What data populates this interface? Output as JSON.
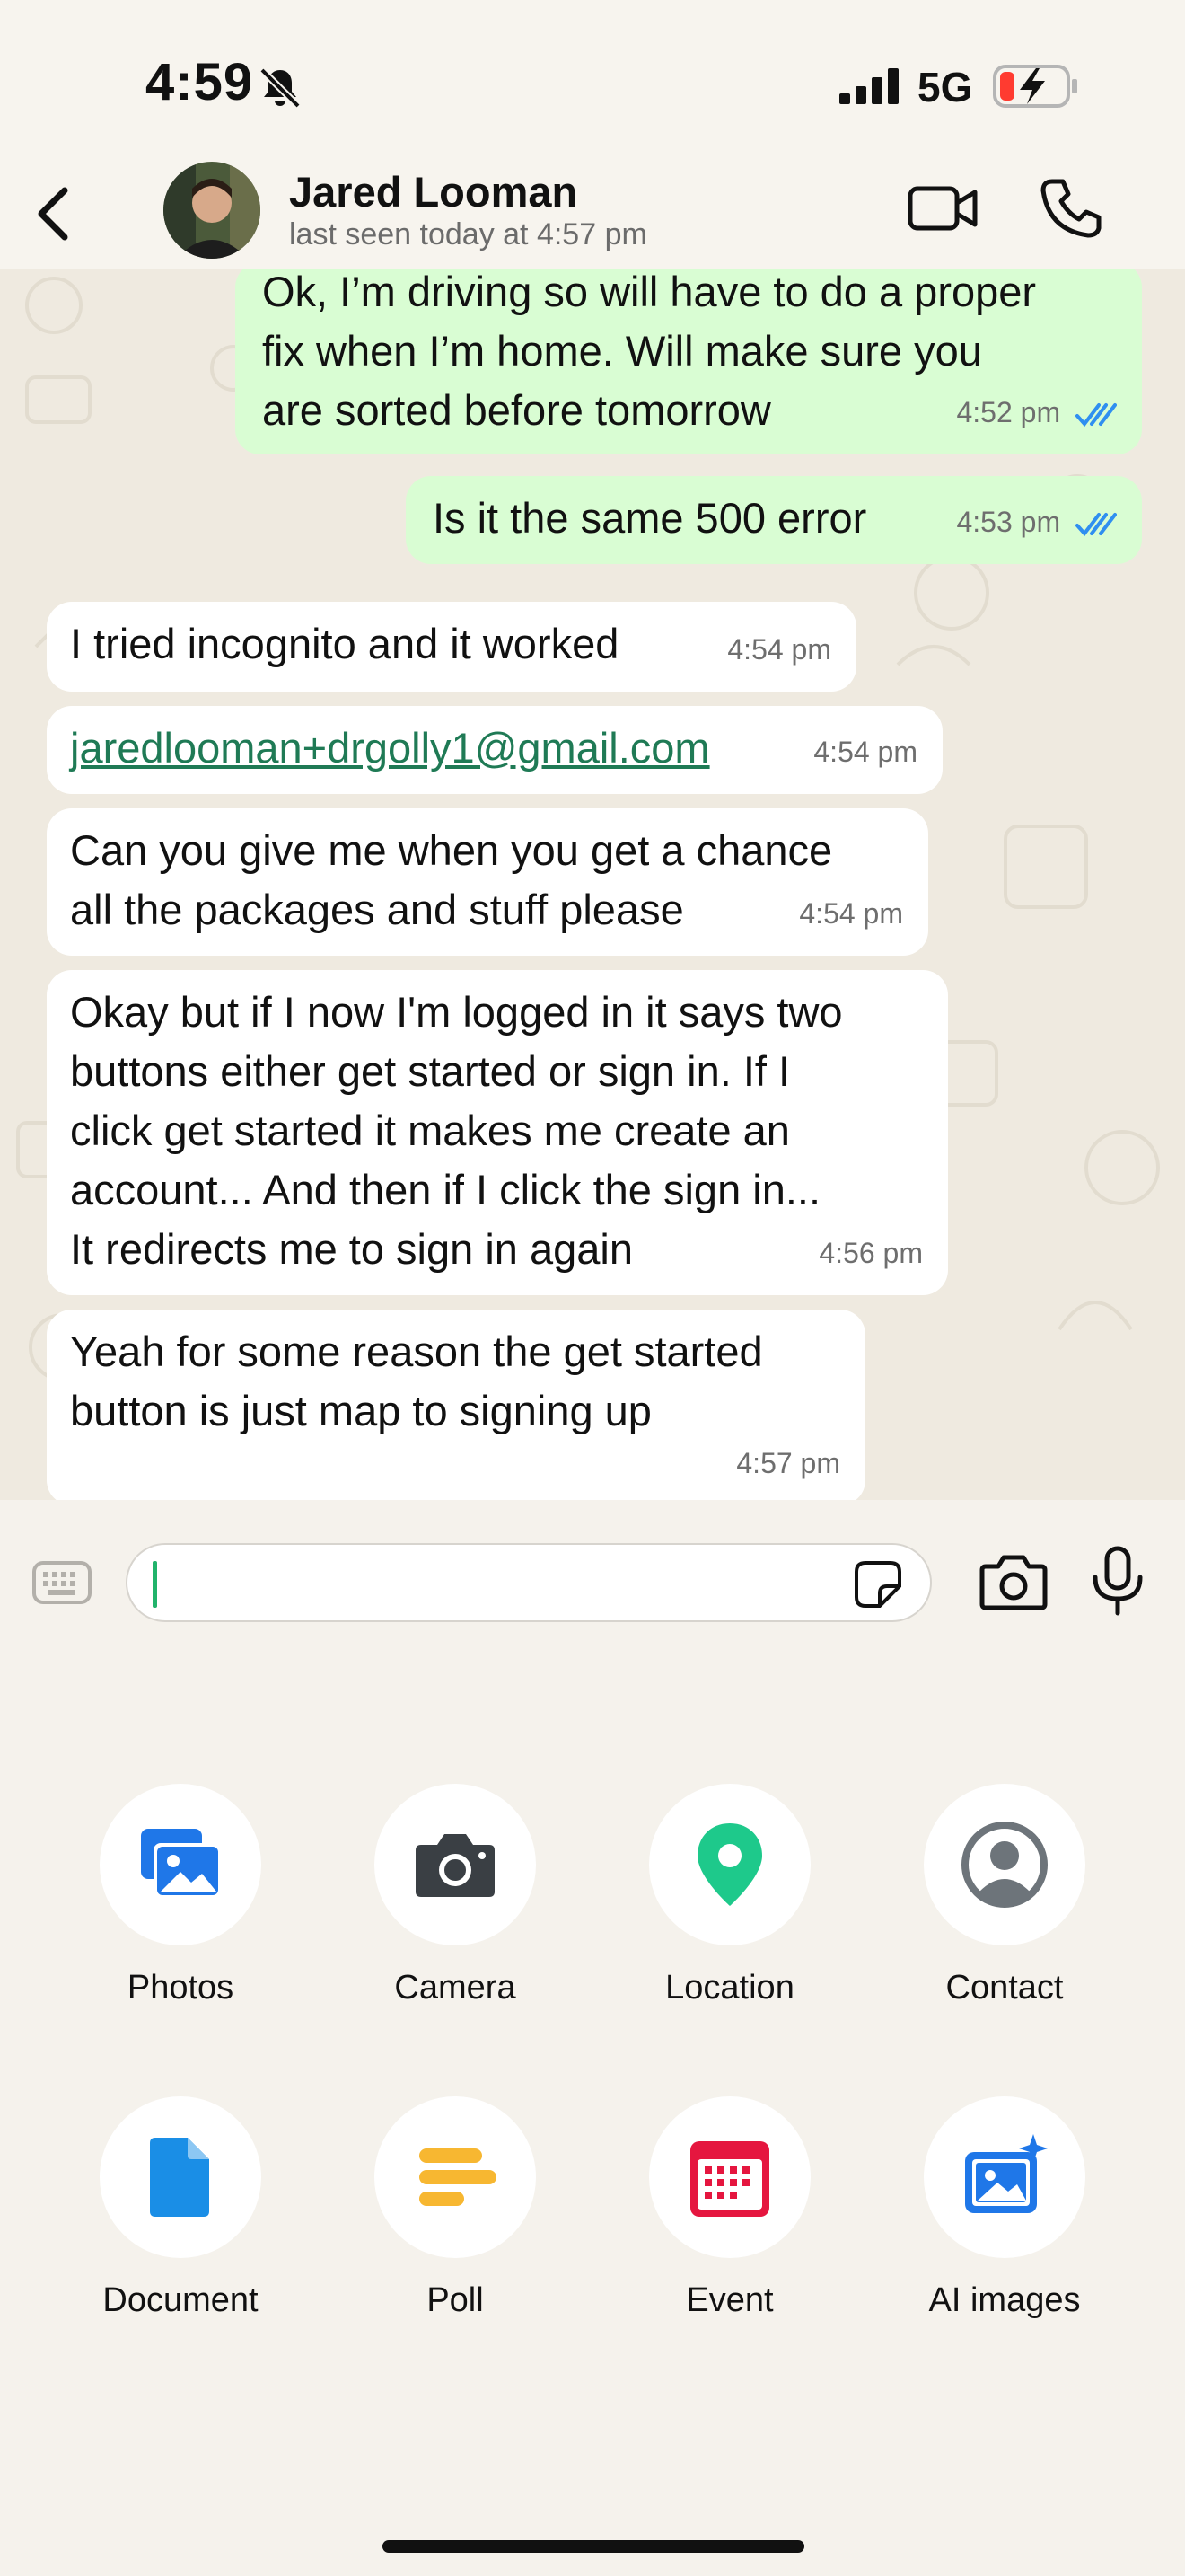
{
  "status_bar": {
    "time": "4:59",
    "network": "5G"
  },
  "header": {
    "contact_name": "Jared Looman",
    "last_seen": "last seen today at 4:57 pm"
  },
  "messages": [
    {
      "direction": "outgoing",
      "text": "Ok, I’m driving so will have to do a proper\nfix when I’m home. Will make sure you\nare sorted before tomorrow",
      "time": "4:52 pm",
      "read": true
    },
    {
      "direction": "outgoing",
      "text": "Is it the same 500 error",
      "time": "4:53 pm",
      "read": true
    },
    {
      "direction": "incoming",
      "text": "I tried incognito and it worked",
      "time": "4:54 pm"
    },
    {
      "direction": "incoming",
      "text": "jaredlooman+drgolly1@gmail.com",
      "time": "4:54 pm",
      "is_link": true
    },
    {
      "direction": "incoming",
      "text": "Can you give me when you get a chance\nall the packages and stuff please",
      "time": "4:54 pm"
    },
    {
      "direction": "incoming",
      "text": "Okay but if I now I'm logged in it says two\nbuttons either get started or sign in. If I\nclick get started it makes me create an\naccount... And then if I click the sign in...\nIt redirects me to sign in again",
      "time": "4:56 pm"
    },
    {
      "direction": "incoming",
      "text": "Yeah for some reason the get started\nbutton is just map to signing up",
      "time": "4:57 pm"
    }
  ],
  "composer": {
    "input_value": ""
  },
  "attachments": [
    {
      "label": "Photos",
      "icon": "photos-icon",
      "color": "#1f77e8"
    },
    {
      "label": "Camera",
      "icon": "camera-icon",
      "color": "#3a3f44"
    },
    {
      "label": "Location",
      "icon": "location-icon",
      "color": "#1ec98b"
    },
    {
      "label": "Contact",
      "icon": "contact-icon",
      "color": "#6d747a"
    },
    {
      "label": "Document",
      "icon": "document-icon",
      "color": "#1a8ee6"
    },
    {
      "label": "Poll",
      "icon": "poll-icon",
      "color": "#f7b731"
    },
    {
      "label": "Event",
      "icon": "event-icon",
      "color": "#e5163f"
    },
    {
      "label": "AI images",
      "icon": "ai-images-icon",
      "color": "#1f77e8"
    }
  ],
  "colors": {
    "outgoing_bubble": "#d9fdd3",
    "incoming_bubble": "#ffffff",
    "read_ticks": "#2f8ff0",
    "link": "#1f7a55",
    "caret": "#21b36b"
  }
}
